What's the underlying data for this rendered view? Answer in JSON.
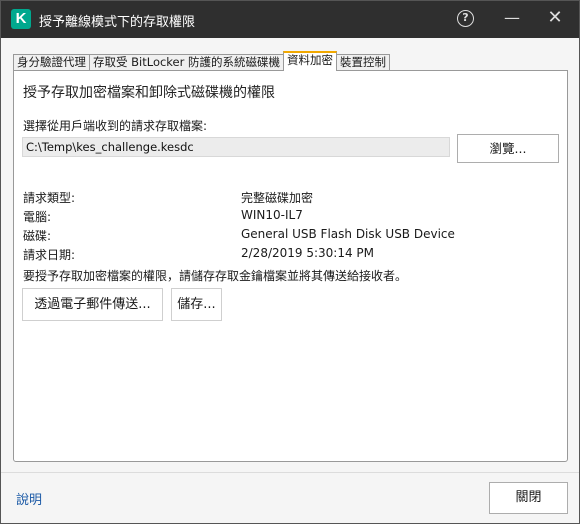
{
  "window": {
    "title": "授予離線模式下的存取權限",
    "logo_letter": "K",
    "help_glyph": "?",
    "minimize_glyph": "—",
    "close_glyph": "✕"
  },
  "tabs": [
    {
      "label": "身分驗證代理",
      "active": false
    },
    {
      "label": "存取受 BitLocker 防護的系統磁碟機",
      "active": false
    },
    {
      "label": "資料加密",
      "active": true
    },
    {
      "label": "裝置控制",
      "active": false
    }
  ],
  "panel": {
    "title": "授予存取加密檔案和卸除式磁碟機的權限",
    "file_label": "選擇從用戶端收到的請求存取檔案:",
    "file_value": "C:\\Temp\\kes_challenge.kesdc",
    "browse_label": "瀏覽...",
    "info": [
      {
        "label": "請求類型:",
        "value": "完整磁碟加密"
      },
      {
        "label": "電腦:",
        "value": "WIN10-IL7"
      },
      {
        "label": "磁碟:",
        "value": "General USB Flash Disk USB Device"
      },
      {
        "label": "請求日期:",
        "value": "2/28/2019 5:30:14 PM"
      }
    ],
    "note": "要授予存取加密檔案的權限，請儲存存取金鑰檔案並將其傳送給接收者。",
    "email_button": "透過電子郵件傳送...",
    "save_button": "儲存..."
  },
  "footer": {
    "help_link": "說明",
    "close_button": "關閉"
  },
  "colors": {
    "titlebar": "#2f2f2f",
    "logo": "#00a88e",
    "active_tab_accent": "#f2a900",
    "link": "#1c5aa6"
  }
}
